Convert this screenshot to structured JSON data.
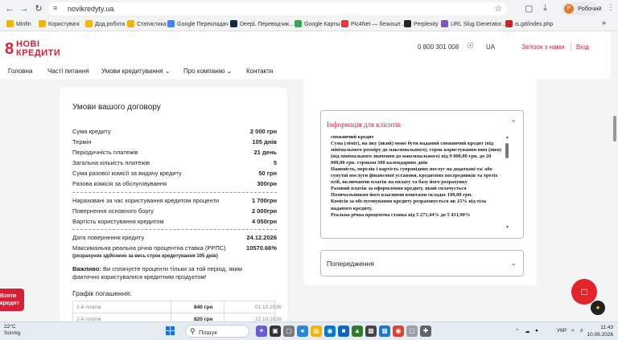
{
  "browser": {
    "url": "novikredyty.ua",
    "profile_label": "Робочий",
    "profile_initial": "Р",
    "bookmarks": [
      "Minfin",
      "Користувачі",
      "Дод.робота",
      "Статистика",
      "Google Перекладач",
      "DeepL Переводчик...",
      "Google Карты",
      "Pic4Net — безкошт...",
      "Perplexity",
      "URL Slug Generator...",
      "is.gd/index.php"
    ]
  },
  "header": {
    "logo_mark": "8",
    "logo_line1": "НОВІ",
    "logo_line2": "КРЕДИТИ",
    "phone": "0 800 301 008",
    "lang": "UA",
    "contact": "Зв'язок з нами",
    "login": "Вхід"
  },
  "nav": {
    "items": [
      "Головна",
      "Часті питання",
      "Умови кредитування",
      "Про компанію",
      "Контакти"
    ]
  },
  "contract": {
    "title": "Умови вашого договору",
    "group1": [
      {
        "label": "Сума кредиту",
        "value": "2 000 грн"
      },
      {
        "label": "Термін",
        "value": "105 днів"
      },
      {
        "label": "Періодичність платежів",
        "value": "21 день"
      },
      {
        "label": "Загальна кількість платежів",
        "value": "5"
      },
      {
        "label": "Сума разової комісії за видачу кредиту",
        "value": "50 грн"
      },
      {
        "label": "Разова комісія за обслуговування",
        "value": "300грн"
      }
    ],
    "group2": [
      {
        "label": "Нараховані за час користування кредитом проценти",
        "value": "1 700грн"
      },
      {
        "label": "Повернення основного боргу",
        "value": "2 000грн"
      },
      {
        "label": "Вартість користування кредитом",
        "value": "4 050грн"
      }
    ],
    "group3": [
      {
        "label": "Дата повернення кредиту",
        "value": "24.12.2026"
      },
      {
        "label": "Максимальна реальна річна процентна ставка (РРПС)",
        "value": "10570.66%"
      }
    ],
    "rrps_note": "(розрахунок здійснено за весь строк кредитування 105 днів)",
    "important_bold": "Важливо:",
    "important_text": " Ви сплачуєте проценти тільки за той період, яким фактично користувалися кредитним продуктом!",
    "schedule_title": "Графік погашення:",
    "schedule": [
      {
        "n": "1-й платіж",
        "amount": "840 грн",
        "date": "01.10.2026"
      },
      {
        "n": "2-й платіж",
        "amount": "820 грн",
        "date": "22.10.2026"
      }
    ]
  },
  "info": {
    "acc1_title": "Інформація для клієнтів",
    "acc1_text": "споживчий кредит\nСума (ліміт), на яку (який) може бути наданий споживчий кредит (від мінімального розміру до максимального), строк користування ним (ним) (від мінімального значення до максимального) від 9 000,00 грн. до 20 000,00 грн. строком 300 календарних днів\nНаявність, перелік і вартість супровідних послуг на додаткові та/ або супутні послуги фінансової установи, кредитних посередників та третіх осіб, включаючи платіж на оплату та базу його розрахунку\nРазовий платіж за оформлення кредиту, який сплачується Позичальником його власними коштами складає 100,00 грн.\nКомісія за обслуговування кредиту розраховується як 15% від тіла наданого кредиту.\nРеальна річна процентна ставка від 5 271,44% до 5 431,90%",
    "acc2_title": "Попередження"
  },
  "float": {
    "take_line1": "Взяти",
    "take_line2": "кредит"
  },
  "taskbar": {
    "temp": "22°C",
    "weather": "Sonnig",
    "search": "Пошук",
    "lang": "УКР",
    "time": "11:43",
    "date": "10.09.2026"
  }
}
